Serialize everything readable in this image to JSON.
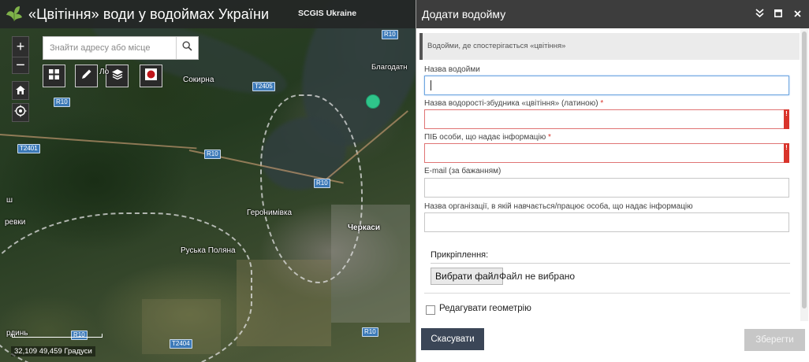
{
  "colors": {
    "header_bg": "#242626",
    "panel_header_bg": "#3d3d3d",
    "cancel_button_bg": "#3b4657",
    "save_button_bg": "#c7c7c7",
    "required_mark": "#d9342b",
    "focus_border": "#6fa6e0",
    "point_marker": "#2fc48a"
  },
  "app": {
    "logo_icon": "leaf-logo-icon",
    "title": "«Цвітіння» води у водоймах України",
    "subtitle": "SCGIS Ukraine"
  },
  "map": {
    "zoom_in_label": "+",
    "zoom_out_label": "−",
    "home_icon": "home-icon",
    "locate_icon": "locate-icon",
    "search": {
      "placeholder": "Знайти адресу або місце",
      "icon": "search-icon"
    },
    "tools": [
      {
        "icon": "basemap-grid-icon"
      },
      {
        "icon": "pencil-icon"
      },
      {
        "icon": "layers-icon"
      },
      {
        "icon": "record-icon"
      }
    ],
    "labels": {
      "sokyrna": "Сокирна",
      "blahodat": "Благодатн",
      "heronymivka": "Геронимівка",
      "cherkasy": "Черкаси",
      "ruska_poliana": "Руська Поляна",
      "revky": "ревки",
      "sh": "ш",
      "rdyn": "рдинь",
      "lo": "Ло"
    },
    "road_shields": [
      "R10",
      "R10",
      "R10",
      "R10",
      "R10",
      "T2405",
      "T2401",
      "T2404",
      "R10"
    ],
    "coordinates": "32,109 49,459 Градуси"
  },
  "panel": {
    "title": "Додати водойму",
    "collapse_icon": "chevron-double-down-icon",
    "maximize_icon": "maximize-icon",
    "close_icon": "close-icon",
    "description": "Водойми, де спостерігається «цвітіння»",
    "fields": {
      "waterbody_name": {
        "label": "Назва водойми",
        "value": ""
      },
      "algae_name": {
        "label": "Назва водорості-збудника «цвітіння» (латиною)",
        "required_mark": "*",
        "value": "",
        "flag": "!"
      },
      "person_name": {
        "label": "ПІБ особи, що надає інформацію",
        "required_mark": "*",
        "value": "",
        "flag": "!"
      },
      "email": {
        "label": "E-mail (за бажанням)",
        "value": ""
      },
      "organization": {
        "label": "Назва організації, в якій навчається/працює особа, що надає інформацію",
        "value": ""
      }
    },
    "attachments": {
      "label": "Прикріплення:",
      "choose_file": "Вибрати файл",
      "file_status": "Файл не вибрано"
    },
    "edit_geometry": {
      "label": "Редагувати геометрію",
      "checked": false
    },
    "buttons": {
      "cancel": "Скасувати",
      "save": "Зберегти"
    }
  }
}
